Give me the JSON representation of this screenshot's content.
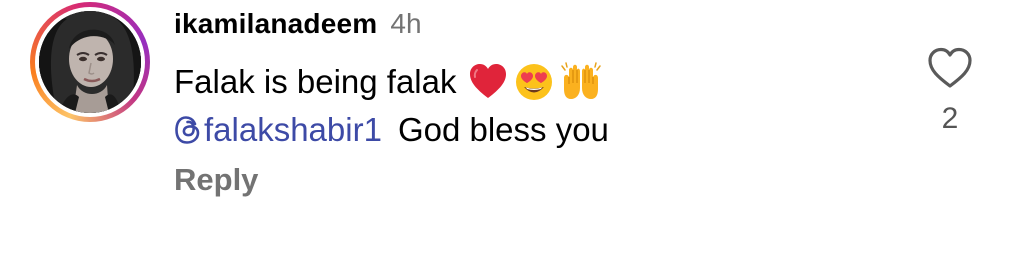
{
  "comment": {
    "username": "ikamilanadeem",
    "time": "4h",
    "text": "Falak is being falak",
    "emojis": [
      "heart-emoji",
      "heart-eyes-emoji",
      "raising-hands-emoji"
    ],
    "mention": "@falakshabir1",
    "mention_text": "falakshabir1",
    "reply_text": "God bless you",
    "reply_label": "Reply",
    "like_count": "2"
  },
  "colors": {
    "mention": "#3d4aa6",
    "muted": "#737373",
    "heart": "#e0243a",
    "ring_start": "#fdc468",
    "ring_end": "#962fbf"
  },
  "icons": {
    "like": "heart-outline-icon",
    "mention": "threads-icon"
  }
}
